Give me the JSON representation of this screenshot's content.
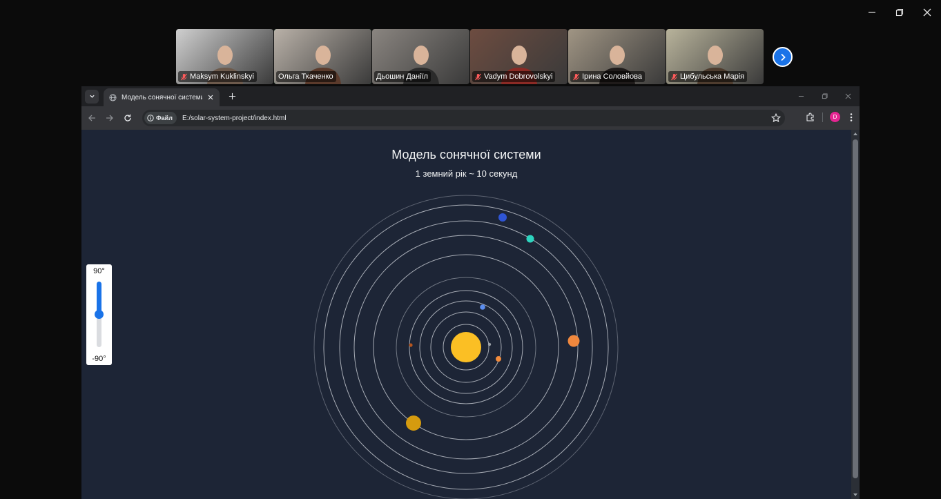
{
  "meeting": {
    "participants": [
      {
        "name": "Maksym Kuklinskyi",
        "muted": true,
        "active": false,
        "bg": "#cfcfcf",
        "tone": "#6d5a4c"
      },
      {
        "name": "Ольга Ткаченко",
        "muted": false,
        "active": true,
        "bg": "#b9b1a8",
        "tone": "#5b3a2b"
      },
      {
        "name": "Дьошин Даніїл",
        "muted": false,
        "active": false,
        "bg": "#8a8580",
        "tone": "#2b2b2b"
      },
      {
        "name": "Vadym Dobrovolskyi",
        "muted": true,
        "active": false,
        "bg": "#6d4c40",
        "tone": "#8b2a25"
      },
      {
        "name": "Ірина Соловйова",
        "muted": true,
        "active": false,
        "bg": "#a09584",
        "tone": "#1f1b1a"
      },
      {
        "name": "Цибульська Марія",
        "muted": true,
        "active": false,
        "bg": "#b8b39b",
        "tone": "#4e3c2e"
      }
    ],
    "next_icon": "chevron-right-icon"
  },
  "browser": {
    "tab_title": "Модель сонячної системи",
    "chip_label": "Файл",
    "url": "E:/solar-system-project/index.html",
    "profile_initial": "D"
  },
  "page": {
    "title": "Модель сонячної системи",
    "subtitle": "1 земний рік ~ 10 секунд",
    "tilt": {
      "max_label": "90°",
      "min_label": "-90°",
      "min": -90,
      "max": 90,
      "value": 0
    }
  },
  "colors": {
    "background": "#1d2536",
    "sun": "#fbbf24",
    "orbit": "#d7dbe2"
  }
}
